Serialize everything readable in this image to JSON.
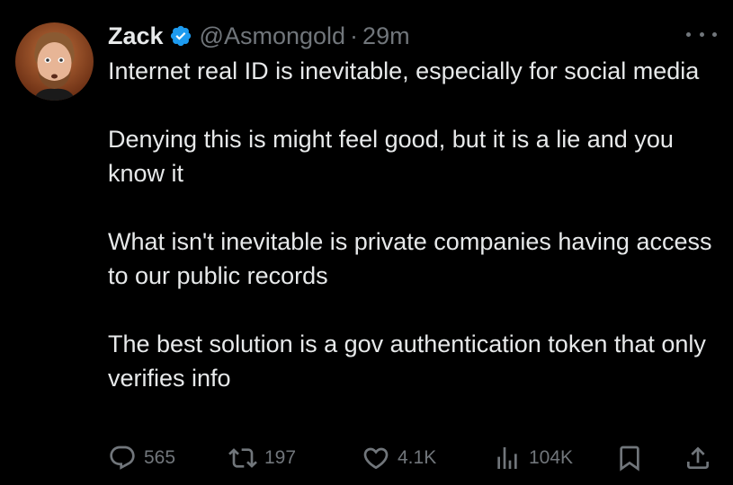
{
  "author": {
    "name": "Zack",
    "handle": "@Asmongold",
    "separator": "·",
    "time": "29m"
  },
  "tweet": {
    "paragraphs": [
      "Internet real ID is inevitable, especially for social media",
      "Denying this is might feel good, but it is a lie and you know it",
      "What isn't inevitable is private companies having access to our public records",
      "The best solution is a gov authentication token that only verifies info"
    ]
  },
  "actions": {
    "replies": "565",
    "reposts": "197",
    "likes": "4.1K",
    "views": "104K"
  },
  "icons": {
    "verified": "verified-badge-icon",
    "more": "more-horizontal-icon",
    "reply": "reply-icon",
    "repost": "repost-icon",
    "like": "heart-icon",
    "views": "views-chart-icon",
    "bookmark": "bookmark-icon",
    "share": "share-icon"
  },
  "colors": {
    "background": "#000000",
    "text": "#e7e9ea",
    "muted": "#71767b",
    "verified": "#1d9bf0"
  }
}
